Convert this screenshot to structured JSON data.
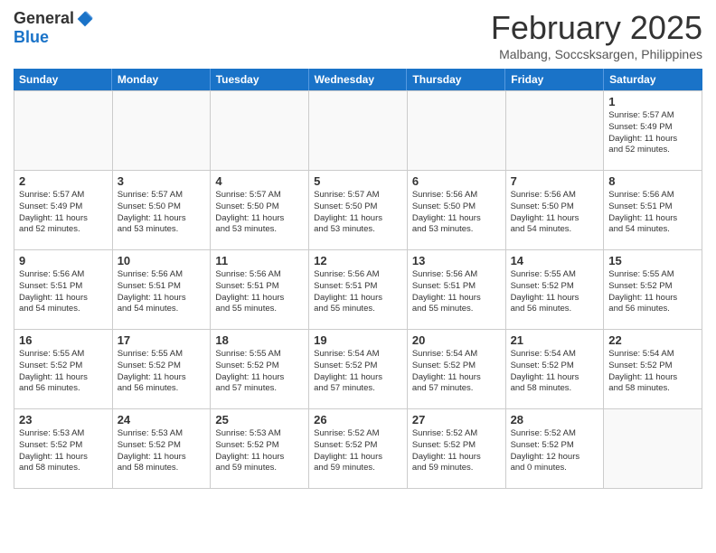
{
  "header": {
    "logo_general": "General",
    "logo_blue": "Blue",
    "month_title": "February 2025",
    "location": "Malbang, Soccsksargen, Philippines"
  },
  "weekdays": [
    "Sunday",
    "Monday",
    "Tuesday",
    "Wednesday",
    "Thursday",
    "Friday",
    "Saturday"
  ],
  "weeks": [
    [
      {
        "day": "",
        "info": ""
      },
      {
        "day": "",
        "info": ""
      },
      {
        "day": "",
        "info": ""
      },
      {
        "day": "",
        "info": ""
      },
      {
        "day": "",
        "info": ""
      },
      {
        "day": "",
        "info": ""
      },
      {
        "day": "1",
        "info": "Sunrise: 5:57 AM\nSunset: 5:49 PM\nDaylight: 11 hours\nand 52 minutes."
      }
    ],
    [
      {
        "day": "2",
        "info": "Sunrise: 5:57 AM\nSunset: 5:49 PM\nDaylight: 11 hours\nand 52 minutes."
      },
      {
        "day": "3",
        "info": "Sunrise: 5:57 AM\nSunset: 5:50 PM\nDaylight: 11 hours\nand 53 minutes."
      },
      {
        "day": "4",
        "info": "Sunrise: 5:57 AM\nSunset: 5:50 PM\nDaylight: 11 hours\nand 53 minutes."
      },
      {
        "day": "5",
        "info": "Sunrise: 5:57 AM\nSunset: 5:50 PM\nDaylight: 11 hours\nand 53 minutes."
      },
      {
        "day": "6",
        "info": "Sunrise: 5:56 AM\nSunset: 5:50 PM\nDaylight: 11 hours\nand 53 minutes."
      },
      {
        "day": "7",
        "info": "Sunrise: 5:56 AM\nSunset: 5:50 PM\nDaylight: 11 hours\nand 54 minutes."
      },
      {
        "day": "8",
        "info": "Sunrise: 5:56 AM\nSunset: 5:51 PM\nDaylight: 11 hours\nand 54 minutes."
      }
    ],
    [
      {
        "day": "9",
        "info": "Sunrise: 5:56 AM\nSunset: 5:51 PM\nDaylight: 11 hours\nand 54 minutes."
      },
      {
        "day": "10",
        "info": "Sunrise: 5:56 AM\nSunset: 5:51 PM\nDaylight: 11 hours\nand 54 minutes."
      },
      {
        "day": "11",
        "info": "Sunrise: 5:56 AM\nSunset: 5:51 PM\nDaylight: 11 hours\nand 55 minutes."
      },
      {
        "day": "12",
        "info": "Sunrise: 5:56 AM\nSunset: 5:51 PM\nDaylight: 11 hours\nand 55 minutes."
      },
      {
        "day": "13",
        "info": "Sunrise: 5:56 AM\nSunset: 5:51 PM\nDaylight: 11 hours\nand 55 minutes."
      },
      {
        "day": "14",
        "info": "Sunrise: 5:55 AM\nSunset: 5:52 PM\nDaylight: 11 hours\nand 56 minutes."
      },
      {
        "day": "15",
        "info": "Sunrise: 5:55 AM\nSunset: 5:52 PM\nDaylight: 11 hours\nand 56 minutes."
      }
    ],
    [
      {
        "day": "16",
        "info": "Sunrise: 5:55 AM\nSunset: 5:52 PM\nDaylight: 11 hours\nand 56 minutes."
      },
      {
        "day": "17",
        "info": "Sunrise: 5:55 AM\nSunset: 5:52 PM\nDaylight: 11 hours\nand 56 minutes."
      },
      {
        "day": "18",
        "info": "Sunrise: 5:55 AM\nSunset: 5:52 PM\nDaylight: 11 hours\nand 57 minutes."
      },
      {
        "day": "19",
        "info": "Sunrise: 5:54 AM\nSunset: 5:52 PM\nDaylight: 11 hours\nand 57 minutes."
      },
      {
        "day": "20",
        "info": "Sunrise: 5:54 AM\nSunset: 5:52 PM\nDaylight: 11 hours\nand 57 minutes."
      },
      {
        "day": "21",
        "info": "Sunrise: 5:54 AM\nSunset: 5:52 PM\nDaylight: 11 hours\nand 58 minutes."
      },
      {
        "day": "22",
        "info": "Sunrise: 5:54 AM\nSunset: 5:52 PM\nDaylight: 11 hours\nand 58 minutes."
      }
    ],
    [
      {
        "day": "23",
        "info": "Sunrise: 5:53 AM\nSunset: 5:52 PM\nDaylight: 11 hours\nand 58 minutes."
      },
      {
        "day": "24",
        "info": "Sunrise: 5:53 AM\nSunset: 5:52 PM\nDaylight: 11 hours\nand 58 minutes."
      },
      {
        "day": "25",
        "info": "Sunrise: 5:53 AM\nSunset: 5:52 PM\nDaylight: 11 hours\nand 59 minutes."
      },
      {
        "day": "26",
        "info": "Sunrise: 5:52 AM\nSunset: 5:52 PM\nDaylight: 11 hours\nand 59 minutes."
      },
      {
        "day": "27",
        "info": "Sunrise: 5:52 AM\nSunset: 5:52 PM\nDaylight: 11 hours\nand 59 minutes."
      },
      {
        "day": "28",
        "info": "Sunrise: 5:52 AM\nSunset: 5:52 PM\nDaylight: 12 hours\nand 0 minutes."
      },
      {
        "day": "",
        "info": ""
      }
    ]
  ]
}
